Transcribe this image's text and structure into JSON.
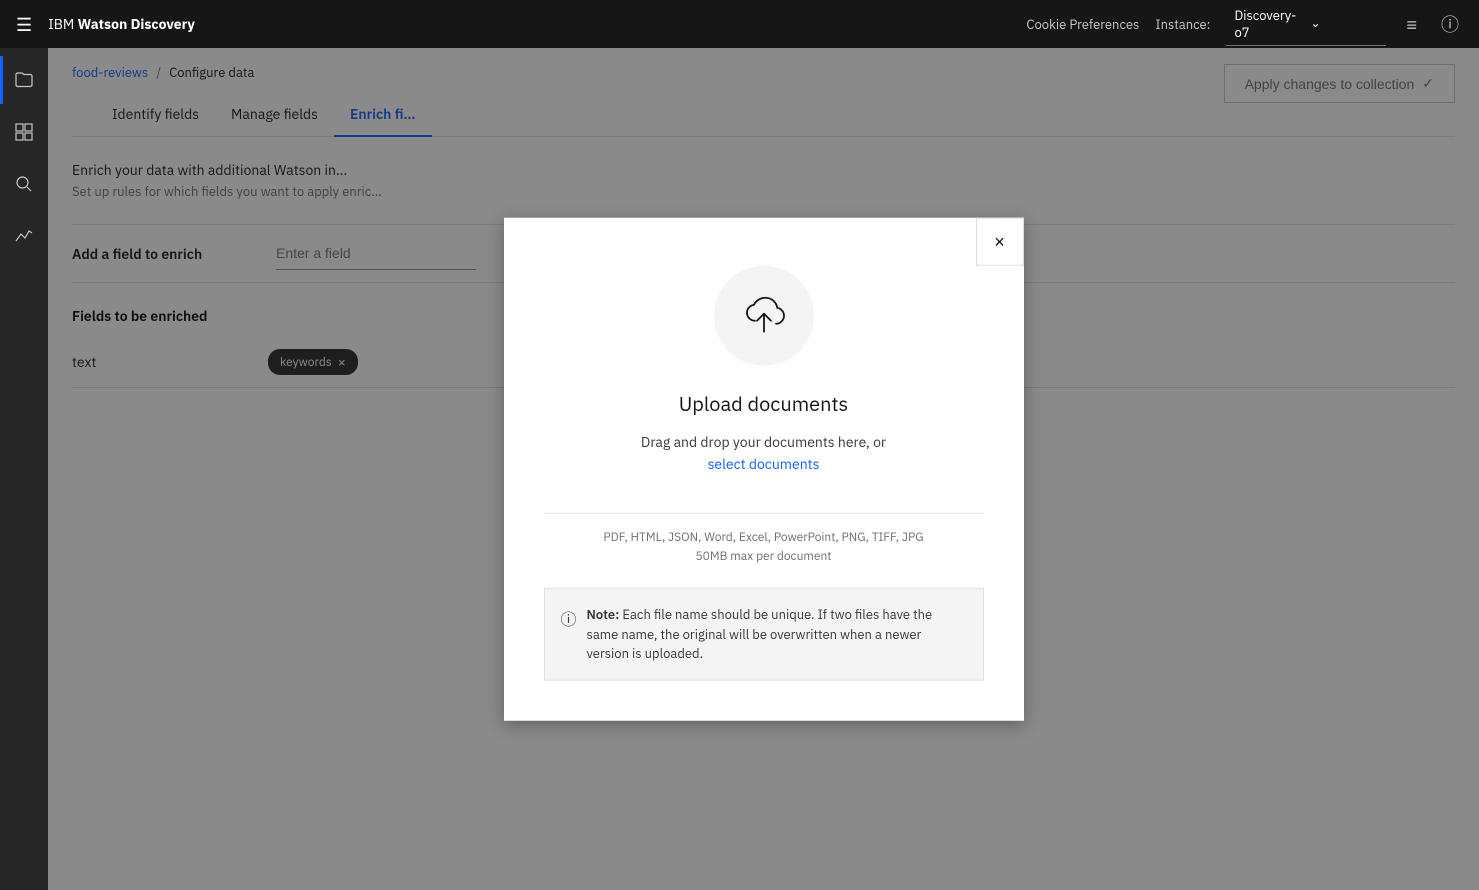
{
  "topnav": {
    "hamburger_label": "☰",
    "title_prefix": "IBM ",
    "title_bold": "Watson Discovery",
    "cookie_prefs": "Cookie Preferences",
    "instance_label": "Instance:",
    "instance_value": "Discovery-o7",
    "chevron": "⌄",
    "list_icon": "≡",
    "info_icon": "ⓘ"
  },
  "sidebar": {
    "items": [
      {
        "id": "folder",
        "icon": "🗂",
        "active": true
      },
      {
        "id": "grid",
        "icon": "⊞",
        "active": false
      },
      {
        "id": "search",
        "icon": "🔍",
        "active": false
      },
      {
        "id": "chart",
        "icon": "📈",
        "active": false
      }
    ]
  },
  "breadcrumb": {
    "link_text": "food-reviews",
    "separator": "/",
    "current": "Configure data"
  },
  "apply_btn": {
    "label": "Apply changes to collection",
    "icon": "✓"
  },
  "tabs": [
    {
      "id": "identify",
      "label": "Identify fields",
      "active": false
    },
    {
      "id": "manage",
      "label": "Manage fields",
      "active": false
    },
    {
      "id": "enrich",
      "label": "Enrich fi…",
      "active": true
    }
  ],
  "enrich_section": {
    "description": "Enrich your data with additional Watson in…",
    "sub": "Set up rules for which fields you want to apply enric…"
  },
  "add_field_row": {
    "label": "Add a field to enrich",
    "placeholder": "Enter a field"
  },
  "fields_section": {
    "title": "Fields to be enriched",
    "fields": [
      {
        "name": "text",
        "tags": [
          {
            "label": "keywords",
            "removable": true
          }
        ]
      }
    ]
  },
  "modal": {
    "close_label": "×",
    "title": "Upload documents",
    "drag_text": "Drag and drop your documents here, or",
    "select_link": "select documents",
    "file_types": "PDF, HTML, JSON, Word, Excel, PowerPoint, PNG, TIFF, JPG",
    "max_size": "50MB max per document",
    "note_icon": "ⓘ",
    "note_text_bold": "Note:",
    "note_text": " Each file name should be unique. If two files have the same name, the original will be overwritten when a newer version is uploaded."
  }
}
